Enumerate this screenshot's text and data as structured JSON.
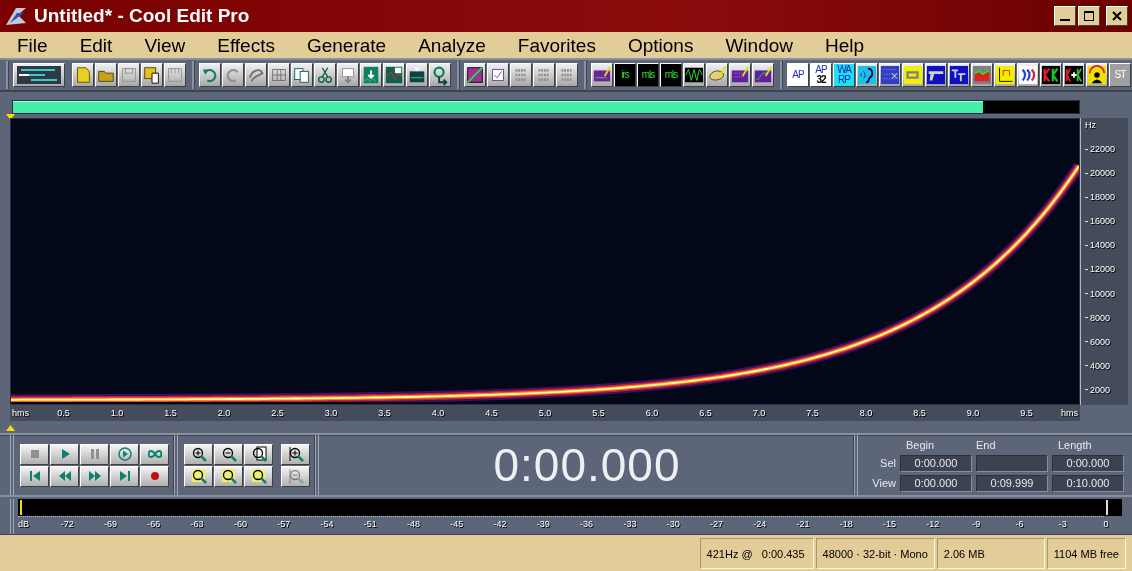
{
  "window": {
    "title": "Untitled* - Cool Edit Pro"
  },
  "menu": [
    "File",
    "Edit",
    "View",
    "Effects",
    "Generate",
    "Analyze",
    "Favorites",
    "Options",
    "Window",
    "Help"
  ],
  "toolbar": {
    "text_buttons": [
      {
        "label": "irs"
      },
      {
        "label": "mls"
      },
      {
        "label": "mls"
      },
      {
        "label": "AP"
      },
      {
        "label": "AP",
        "sub": "32"
      },
      {
        "label": "WARP"
      },
      {
        "label": "ST"
      }
    ]
  },
  "spectrogram": {
    "frequency_unit": "Hz",
    "frequency_ticks": [
      "22000",
      "20000",
      "18000",
      "16000",
      "14000",
      "12000",
      "10000",
      "8000",
      "6000",
      "4000",
      "2000"
    ],
    "time_unit_left": "hms",
    "time_unit_right": "hms",
    "time_ticks": [
      "0.5",
      "1.0",
      "1.5",
      "2.0",
      "2.5",
      "3.0",
      "3.5",
      "4.0",
      "4.5",
      "5.0",
      "5.5",
      "6.0",
      "6.5",
      "7.0",
      "7.5",
      "8.0",
      "8.5",
      "9.0",
      "9.5"
    ]
  },
  "time_display": "0:00.000",
  "selection": {
    "columns": [
      "Begin",
      "End",
      "Length"
    ],
    "rows": [
      {
        "label": "Sel",
        "begin": "0:00.000",
        "length": "0:00.000"
      },
      {
        "label": "View",
        "begin": "0:00.000",
        "end": "0:09.999",
        "length": "0:10.000"
      }
    ]
  },
  "level_meter": {
    "unit": "dB",
    "ticks": [
      "-72",
      "-69",
      "-66",
      "-63",
      "-60",
      "-57",
      "-54",
      "-51",
      "-48",
      "-45",
      "-42",
      "-39",
      "-36",
      "-33",
      "-30",
      "-27",
      "-24",
      "-21",
      "-18",
      "-15",
      "-12",
      "-9",
      "-6",
      "-3",
      "0"
    ]
  },
  "status_bar": [
    "421Hz @   0:00.435",
    "48000 · 32-bit · Mono",
    "2.06 MB",
    "1104 MB free"
  ]
}
